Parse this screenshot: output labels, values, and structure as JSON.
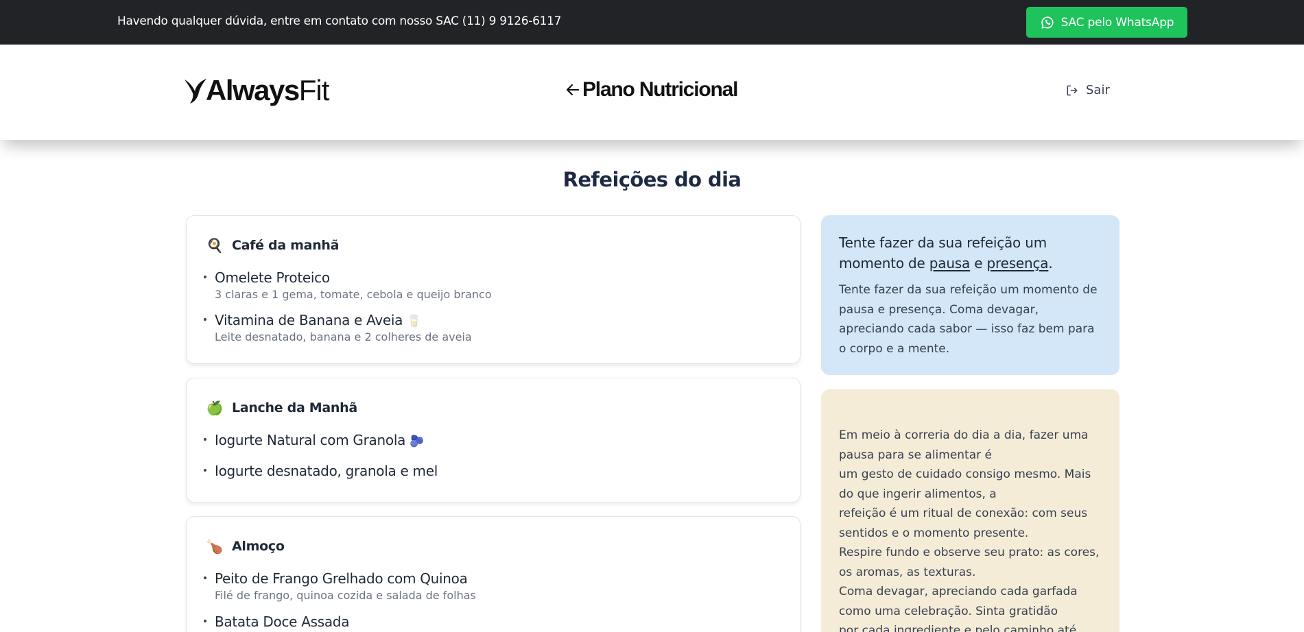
{
  "topbar": {
    "support_text": "Havendo qualquer dúvida, entre em contato com nosso SAC (11) 9 9126-6117",
    "whatsapp_button": "SAC pelo WhatsApp",
    "whatsapp_icon": "whatsapp-icon"
  },
  "header": {
    "logo_bold": "Always",
    "logo_light": "Fit",
    "back_icon": "arrow-left-icon",
    "title": "Plano Nutricional",
    "logout_icon": "logout-icon",
    "logout_label": "Sair"
  },
  "main": {
    "section_title": "Refeições do dia",
    "meals": [
      {
        "emoji": "🍳",
        "title": "Café da manhã",
        "items": [
          {
            "name": "Omelete Proteico",
            "desc": "3 claras e 1 gema, tomate, cebola e queijo branco",
            "emoji": ""
          },
          {
            "name": "Vitamina de Banana e Aveia",
            "desc": "Leite desnatado, banana e 2 colheres de aveia",
            "emoji": "🥛"
          }
        ]
      },
      {
        "emoji": "🍏",
        "title": "Lanche da Manhã",
        "items": [
          {
            "name": "Iogurte Natural com Granola",
            "desc": "",
            "emoji": "🫐"
          },
          {
            "name": "Iogurte desnatado, granola e mel",
            "desc": "",
            "emoji": ""
          }
        ]
      },
      {
        "emoji": "🍗",
        "title": "Almoço",
        "items": [
          {
            "name": "Peito de Frango Grelhado com Quinoa",
            "desc": "Filé de frango, quinoa cozida e salada de folhas",
            "emoji": ""
          },
          {
            "name": "Batata Doce Assada",
            "desc": "",
            "emoji": ""
          }
        ]
      }
    ]
  },
  "tip": {
    "heading_start": "Tente fazer da sua refeição um momento de ",
    "heading_word1": "pausa",
    "heading_and": " e ",
    "heading_word2": "presença",
    "heading_end": ".",
    "text": "Tente fazer da sua refeição um momento de pausa e presença. Coma devagar, apreciando cada sabor — isso faz bem para o corpo e a mente.",
    "background": "#d3e7f8"
  },
  "reflection": {
    "lines": [
      "Em meio à correria do dia a dia, fazer uma pausa para se alimentar é",
      "um gesto de cuidado consigo mesmo. Mais do que ingerir alimentos, a",
      "refeição é um ritual de conexão: com seus sentidos e o momento presente.",
      "Respire fundo e observe seu prato: as cores, os aromas, as texturas.",
      "Coma devagar, apreciando cada garfada como uma celebração. Sinta gratidão",
      "por cada ingrediente e pelo caminho até chegar"
    ],
    "background": "#f5ecd8"
  },
  "colors": {
    "topbar": "#222326",
    "whatsapp": "#1ec35c",
    "title": "#1e2a44"
  }
}
